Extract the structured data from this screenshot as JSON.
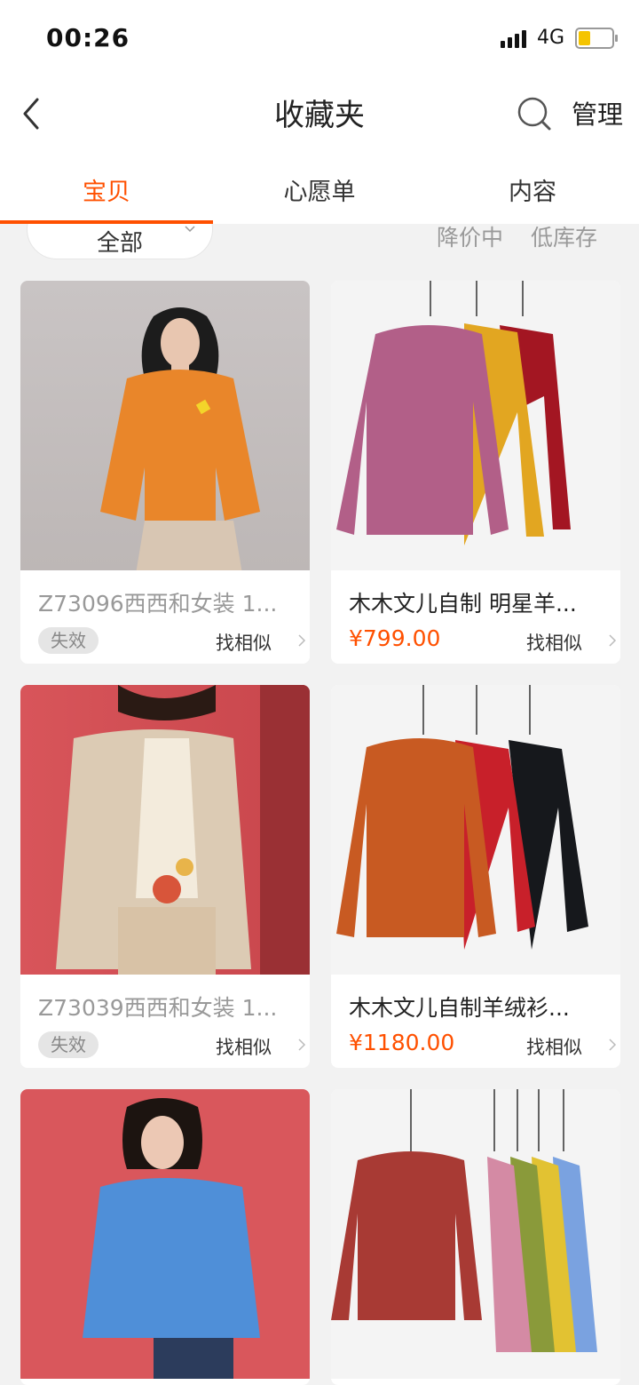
{
  "status": {
    "time": "00:26",
    "network": "4G",
    "battery_level": 0.35,
    "battery_color": "#f5c400"
  },
  "nav": {
    "title": "收藏夹",
    "manage_label": "管理",
    "back_icon": "chevron-left-icon",
    "search_icon": "search-icon"
  },
  "tabs": [
    {
      "label": "宝贝",
      "active": true
    },
    {
      "label": "心愿单",
      "active": false
    },
    {
      "label": "内容",
      "active": false
    }
  ],
  "filter": {
    "selected": "全部",
    "tags": [
      "降价中",
      "低库存"
    ]
  },
  "accent_color": "#ff5000",
  "items": [
    {
      "title": "Z73096西西和女装 1...",
      "status": "失效",
      "price": "",
      "similar_label": "找相似",
      "image": "woman-orange-cardigan"
    },
    {
      "title": "木木文儿自制 明星羊...",
      "status": "",
      "price": "¥799.00",
      "similar_label": "找相似",
      "image": "hanging-cardigans-pink-yellow-red"
    },
    {
      "title": "Z73039西西和女装 1...",
      "status": "失效",
      "price": "",
      "similar_label": "找相似",
      "image": "woman-beige-cardigan"
    },
    {
      "title": "木木文儿自制羊绒衫...",
      "status": "",
      "price": "¥1180.00",
      "similar_label": "找相似",
      "image": "hanging-cardigans-orange-red-black"
    },
    {
      "title": "",
      "status": "",
      "price": "",
      "similar_label": "",
      "image": "woman-blue-sweater"
    },
    {
      "title": "",
      "status": "",
      "price": "",
      "similar_label": "",
      "image": "hanging-sweaters-multicolor"
    }
  ]
}
